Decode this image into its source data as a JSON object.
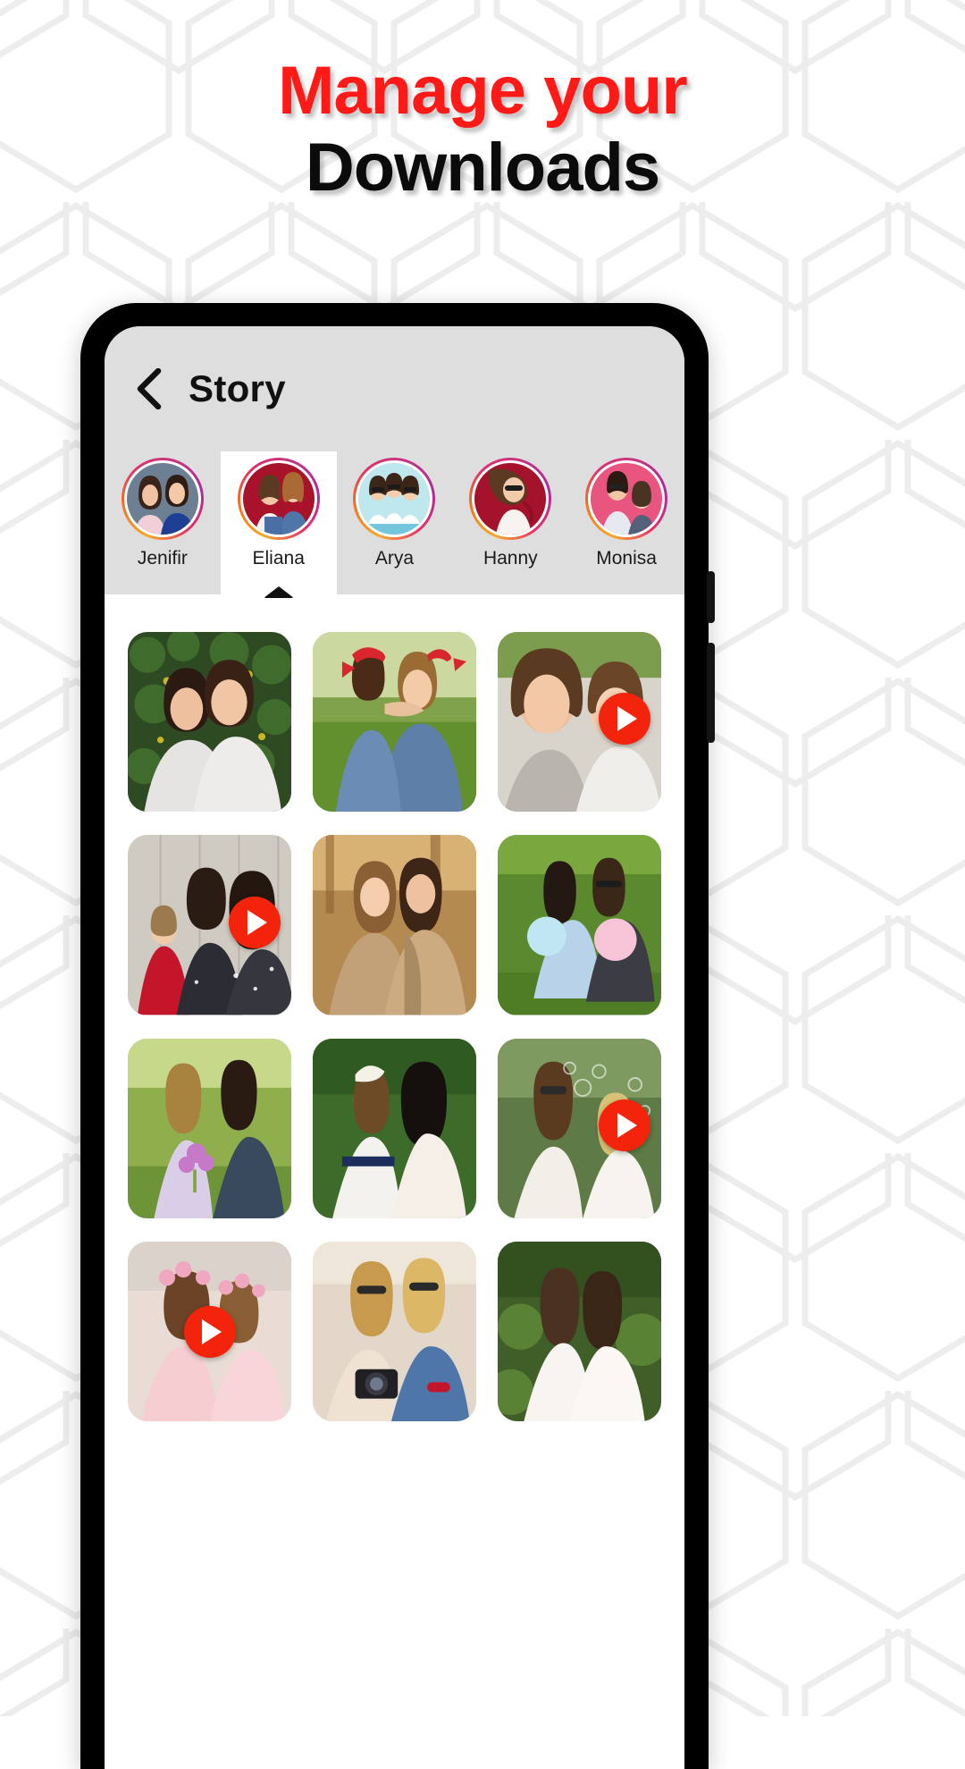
{
  "headline": {
    "line1": "Manage your",
    "line2": "Downloads",
    "line1_color": "#FF1A18",
    "line2_color": "#0B0B0B"
  },
  "phone": {
    "header_bg": "#DEDEDE",
    "accent": "#F4240C"
  },
  "app": {
    "back_icon": "back-chevron-icon",
    "title": "Story"
  },
  "stories": [
    {
      "name": "Jenifir",
      "active": false
    },
    {
      "name": "Eliana",
      "active": true
    },
    {
      "name": "Arya",
      "active": false
    },
    {
      "name": "Hanny",
      "active": false
    },
    {
      "name": "Monisa",
      "active": false
    }
  ],
  "grid": {
    "columns": 3,
    "items": [
      {
        "id": 1,
        "type": "photo",
        "video": false,
        "alt": "two women hugging in front of green ivy"
      },
      {
        "id": 2,
        "type": "photo",
        "video": false,
        "alt": "mother and daughter with red bandanas in denim"
      },
      {
        "id": 3,
        "type": "video",
        "video": true,
        "alt": "mother and young daughter close up",
        "play_position": "right"
      },
      {
        "id": 4,
        "type": "video",
        "video": true,
        "alt": "toddler in red with two women by wooden wall",
        "play_position": "right"
      },
      {
        "id": 5,
        "type": "photo",
        "video": false,
        "alt": "two women in beige coats in autumn light"
      },
      {
        "id": 6,
        "type": "photo",
        "video": false,
        "alt": "two women with cotton candy on grass"
      },
      {
        "id": 7,
        "type": "photo",
        "video": false,
        "alt": "girl with flower bouquet and woman in garden"
      },
      {
        "id": 8,
        "type": "photo",
        "video": false,
        "alt": "girl in white dress with dark haired woman"
      },
      {
        "id": 9,
        "type": "video",
        "video": true,
        "alt": "woman and girl blowing bubbles",
        "play_position": "right"
      },
      {
        "id": 10,
        "type": "video",
        "video": true,
        "alt": "woman and girl with flower crowns in pink",
        "play_position": "center"
      },
      {
        "id": 11,
        "type": "photo",
        "video": false,
        "alt": "two blonde women with sunglasses and camera"
      },
      {
        "id": 12,
        "type": "photo",
        "video": false,
        "alt": "two women in white dresses leaning together"
      }
    ]
  }
}
